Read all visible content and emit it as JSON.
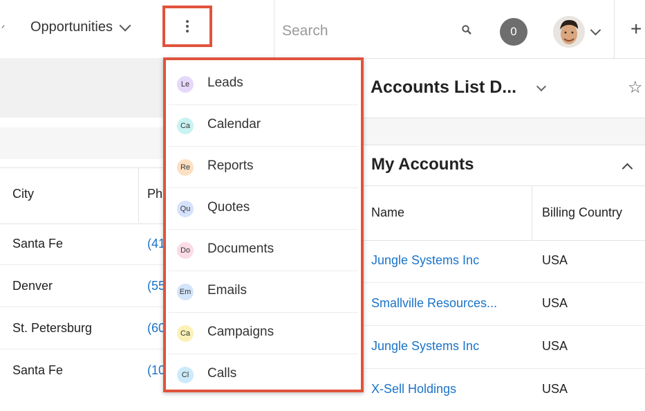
{
  "header": {
    "module_tab": "Opportunities",
    "search_placeholder": "Search",
    "notification_count": "0"
  },
  "more_menu": {
    "items": [
      {
        "abbr": "Le",
        "label": "Leads",
        "color": "#e6d8fb"
      },
      {
        "abbr": "Ca",
        "label": "Calendar",
        "color": "#c9f2f2"
      },
      {
        "abbr": "Re",
        "label": "Reports",
        "color": "#fde0c4"
      },
      {
        "abbr": "Qu",
        "label": "Quotes",
        "color": "#d6e2fb"
      },
      {
        "abbr": "Do",
        "label": "Documents",
        "color": "#fadbe6"
      },
      {
        "abbr": "Em",
        "label": "Emails",
        "color": "#d3e5fb"
      },
      {
        "abbr": "Ca",
        "label": "Campaigns",
        "color": "#fbf1b6"
      },
      {
        "abbr": "Cl",
        "label": "Calls",
        "color": "#cdeafa"
      }
    ]
  },
  "left_list": {
    "columns": [
      "City",
      "Ph"
    ],
    "rows": [
      {
        "city": "Santa Fe",
        "phone": "(41"
      },
      {
        "city": "Denver",
        "phone": "(55"
      },
      {
        "city": "St. Petersburg",
        "phone": "(60"
      },
      {
        "city": "Santa Fe",
        "phone": "(10"
      }
    ]
  },
  "dashboard": {
    "title": "Accounts List D...",
    "dashlet_title": "My Accounts",
    "columns": [
      "Name",
      "Billing Country"
    ],
    "rows": [
      {
        "name": "Jungle Systems Inc",
        "country": "USA"
      },
      {
        "name": "Smallville Resources...",
        "country": "USA"
      },
      {
        "name": "Jungle Systems Inc",
        "country": "USA"
      },
      {
        "name": "X-Sell Holdings",
        "country": "USA"
      }
    ]
  }
}
